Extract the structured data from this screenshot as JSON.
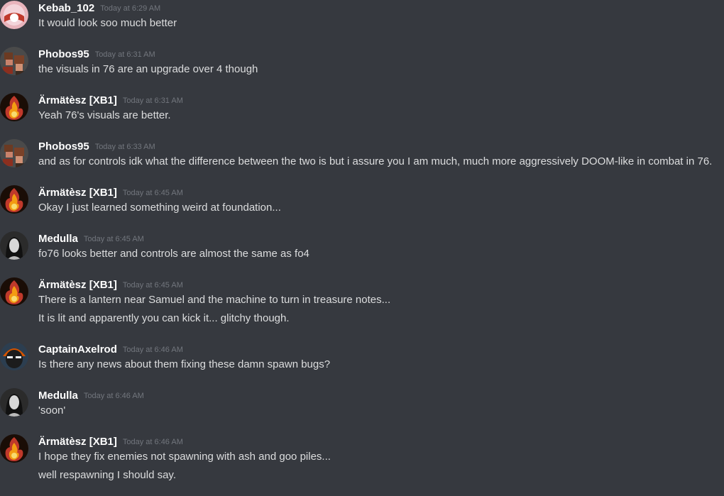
{
  "colors": {
    "background": "#36393f",
    "author": "#ffffff",
    "timestamp": "#72767d",
    "text": "#dcddde"
  },
  "messages": [
    {
      "author": "Kebab_102",
      "timestamp": "Today at 6:29 AM",
      "avatar": "pink-avatar",
      "lines": [
        "It would look soo much better"
      ]
    },
    {
      "author": "Phobos95",
      "timestamp": "Today at 6:31 AM",
      "avatar": "pixel-character-avatar",
      "lines": [
        "the visuals in 76 are an upgrade over 4 though"
      ]
    },
    {
      "author": "Ärmätèsz [XB1]",
      "timestamp": "Today at 6:31 AM",
      "avatar": "flame-avatar",
      "lines": [
        "Yeah 76's visuals are better."
      ]
    },
    {
      "author": "Phobos95",
      "timestamp": "Today at 6:33 AM",
      "avatar": "pixel-character-avatar",
      "lines": [
        "and as for controls idk what the difference between the two is but i assure you I am much, much more aggressively DOOM-like in combat in 76."
      ]
    },
    {
      "author": "Ärmätèsz [XB1]",
      "timestamp": "Today at 6:45 AM",
      "avatar": "flame-avatar",
      "lines": [
        "Okay I just learned something weird at foundation..."
      ]
    },
    {
      "author": "Medulla",
      "timestamp": "Today at 6:45 AM",
      "avatar": "grayscale-portrait-avatar",
      "lines": [
        "fo76 looks better and controls are almost the same as fo4"
      ]
    },
    {
      "author": "Ärmätèsz [XB1]",
      "timestamp": "Today at 6:45 AM",
      "avatar": "flame-avatar",
      "lines": [
        "There is a lantern near Samuel and the machine to turn in treasure notes...",
        "It is lit and apparently you can kick it... glitchy though."
      ]
    },
    {
      "author": "CaptainAxelrod",
      "timestamp": "Today at 6:46 AM",
      "avatar": "masked-face-avatar",
      "lines": [
        "Is there any news about them fixing these damn spawn bugs?"
      ]
    },
    {
      "author": "Medulla",
      "timestamp": "Today at 6:46 AM",
      "avatar": "grayscale-portrait-avatar",
      "lines": [
        "'soon'"
      ]
    },
    {
      "author": "Ärmätèsz [XB1]",
      "timestamp": "Today at 6:46 AM",
      "avatar": "flame-avatar",
      "lines": [
        "I hope they fix enemies not spawning with ash and goo piles...",
        "well respawning I should say."
      ]
    }
  ]
}
